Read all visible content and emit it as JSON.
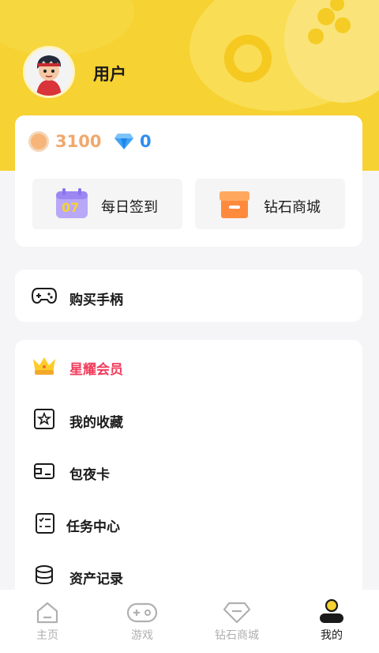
{
  "profile": {
    "username": "用户"
  },
  "wallet": {
    "coins": "3100",
    "diamonds": "0"
  },
  "quick_actions": [
    {
      "label": "每日签到",
      "icon": "calendar-icon",
      "badge": "07"
    },
    {
      "label": "钻石商城",
      "icon": "shop-box-icon"
    }
  ],
  "buy_controller": {
    "label": "购买手柄",
    "icon": "gamepad-icon"
  },
  "menu": [
    {
      "label": "星耀会员",
      "icon": "crown-icon"
    },
    {
      "label": "我的收藏",
      "icon": "star-bookmark-icon"
    },
    {
      "label": "包夜卡",
      "icon": "card-icon"
    },
    {
      "label": "任务中心",
      "icon": "checklist-icon"
    },
    {
      "label": "资产记录",
      "icon": "coin-stack-icon"
    }
  ],
  "tabs": [
    {
      "label": "主页",
      "icon": "home-icon",
      "active": false
    },
    {
      "label": "游戏",
      "icon": "gamepad-icon",
      "active": false
    },
    {
      "label": "钻石商城",
      "icon": "diamond-icon",
      "active": false
    },
    {
      "label": "我的",
      "icon": "profile-icon",
      "active": true
    }
  ],
  "colors": {
    "brand_yellow": "#f6d232",
    "coin": "#f1a86b",
    "diamond": "#2f8df0",
    "vip": "#f23c5c"
  }
}
